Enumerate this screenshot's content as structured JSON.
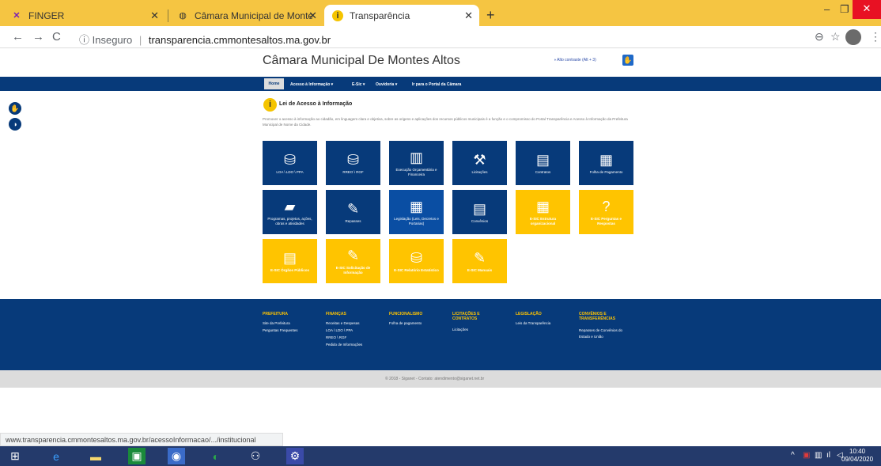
{
  "browser": {
    "tabs": [
      {
        "title": "FINGER",
        "active": false
      },
      {
        "title": "Câmara Municipal de Montes Alt",
        "active": false
      },
      {
        "title": "Transparência",
        "active": true
      }
    ],
    "url_insecure": "Inseguro",
    "url_host": "transparencia.cmmontesaltos.ma.gov.br",
    "status_url": "www.transparencia.cmmontesaltos.ma.gov.br/acessoInformacao/.../institucional"
  },
  "header": {
    "title": "Câmara Municipal De Montes Altos",
    "contrast": "Alto contraste (Alt + 3)"
  },
  "nav": {
    "items": [
      "Home",
      "Acesso à Informação ▾",
      "E-Sic ▾",
      "Ouvidoria ▾",
      "Ir para o Portal da Câmara"
    ]
  },
  "section": {
    "title": "Lei de Acesso à Informação",
    "description": "Promover o acesso à informação ao cidadão, em linguagem clara e objetiva, sobre as origens e aplicações dos recursos públicos municipais é a função e o compromisso do Portal Transparência e Acesso à Informação da Prefeitura Municipal de Nome da Cidade."
  },
  "tiles": [
    {
      "label": "LOA \\ LDO \\ PPA",
      "color": "blue",
      "icon": "coins-database-icon"
    },
    {
      "label": "RREO \\ RGF",
      "color": "blue",
      "icon": "coins-database-icon"
    },
    {
      "label": "Execução Orçamentária e Financeira",
      "color": "blue",
      "icon": "presentation-icon"
    },
    {
      "label": "Licitações",
      "color": "blue",
      "icon": "gavel-icon"
    },
    {
      "label": "Contratos",
      "color": "blue",
      "icon": "document-icon"
    },
    {
      "label": "Folha de Pagamento",
      "color": "blue",
      "icon": "clipboard-icon"
    },
    {
      "label": "Programas, projetos, ações, obras e atividades",
      "color": "blue",
      "icon": "folder-icon"
    },
    {
      "label": "Repasses",
      "color": "blue",
      "icon": "edit-icon"
    },
    {
      "label": "Legislação (Leis, Decretos e Portarias)",
      "color": "blue",
      "icon": "calendar-icon"
    },
    {
      "label": "Convênios",
      "color": "blue",
      "icon": "document-icon"
    },
    {
      "label": "E-SIC Estrutura organizacional",
      "color": "yellow",
      "icon": "building-icon"
    },
    {
      "label": "E-SIC Perguntas e Respostas",
      "color": "yellow",
      "icon": "question-icon"
    },
    {
      "label": "E-SIC Órgãos Públicos",
      "color": "yellow",
      "icon": "document-icon"
    },
    {
      "label": "E-SIC Solicitação de Informação",
      "color": "yellow",
      "icon": "edit-icon"
    },
    {
      "label": "E-SIC Relatório Estatístico",
      "color": "yellow",
      "icon": "coins-database-icon"
    },
    {
      "label": "E-SIC Manuais",
      "color": "yellow",
      "icon": "edit-icon"
    }
  ],
  "footer": {
    "columns": [
      {
        "heading": "PREFEITURA",
        "links": [
          "Site da Prefeitura",
          "Perguntas Frequentes"
        ]
      },
      {
        "heading": "FINANÇAS",
        "links": [
          "Receitas e Despesas",
          "LOA \\ LDO \\ PPA",
          "RREO \\ RGF",
          "Pedido de Informações"
        ]
      },
      {
        "heading": "FUNCIONALISMO",
        "links": [
          "Folha de pagamento"
        ]
      },
      {
        "heading": "LICITAÇÕES E CONTRATOS",
        "links": [
          "Licitações"
        ]
      },
      {
        "heading": "LEGISLAÇÃO",
        "links": [
          "Leis da Transparência"
        ]
      },
      {
        "heading": "CONVÊNIOS E TRANSFERÊNCIAS",
        "links": [
          "Repasses de Convênios do Estado e União"
        ]
      }
    ],
    "copyright": "© 2018 - Siganet - Contato: atendimento@siganet.net.br"
  },
  "taskbar": {
    "time": "10:40",
    "date": "09/04/2020"
  }
}
